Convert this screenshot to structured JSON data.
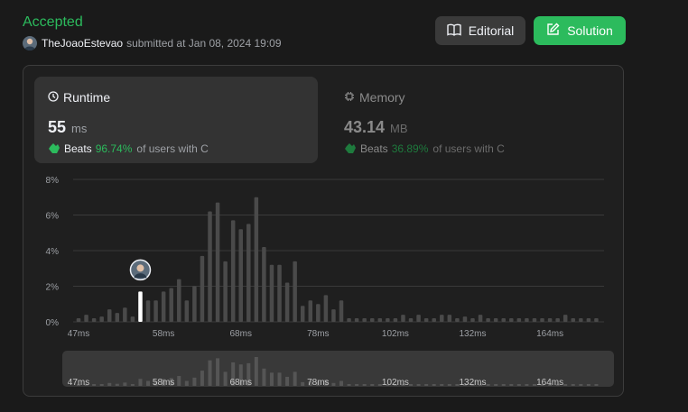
{
  "header": {
    "status": "Accepted",
    "username": "TheJoaoEstevao",
    "submitted_text": "submitted at Jan 08, 2024 19:09",
    "editorial_label": "Editorial",
    "solution_label": "Solution"
  },
  "runtime": {
    "title": "Runtime",
    "value": "55",
    "unit": "ms",
    "beats_label": "Beats",
    "beats_pct": "96.74%",
    "beats_suffix": "of users with C"
  },
  "memory": {
    "title": "Memory",
    "value": "43.14",
    "unit": "MB",
    "beats_label": "Beats",
    "beats_pct": "36.89%",
    "beats_suffix": "of users with C"
  },
  "colors": {
    "accent_green": "#2cbb5d",
    "background": "#1a1a1a",
    "bar": "#4a4a4a",
    "highlight_bar": "#ffffff"
  },
  "chart_data": {
    "type": "bar",
    "ylim": [
      0,
      8
    ],
    "yticks": [
      "0%",
      "2%",
      "4%",
      "6%",
      "8%"
    ],
    "xticks": [
      {
        "label": "47ms",
        "i": 0
      },
      {
        "label": "58ms",
        "i": 11
      },
      {
        "label": "68ms",
        "i": 21
      },
      {
        "label": "78ms",
        "i": 31
      },
      {
        "label": "102ms",
        "i": 41
      },
      {
        "label": "132ms",
        "i": 51
      },
      {
        "label": "164ms",
        "i": 61
      }
    ],
    "highlight_index": 8,
    "values": [
      0.2,
      0.4,
      0.2,
      0.3,
      0.7,
      0.5,
      0.8,
      0.3,
      1.7,
      1.2,
      1.2,
      1.7,
      1.9,
      2.4,
      1.2,
      2.0,
      3.7,
      6.2,
      6.7,
      3.4,
      5.7,
      5.2,
      5.5,
      7.0,
      4.2,
      3.2,
      3.2,
      2.2,
      3.4,
      0.9,
      1.2,
      1.0,
      1.5,
      0.7,
      1.2,
      0.2,
      0.2,
      0.2,
      0.2,
      0.2,
      0.2,
      0.2,
      0.4,
      0.2,
      0.4,
      0.2,
      0.2,
      0.4,
      0.4,
      0.2,
      0.3,
      0.2,
      0.4,
      0.2,
      0.2,
      0.2,
      0.2,
      0.2,
      0.2,
      0.2,
      0.2,
      0.2,
      0.2,
      0.4,
      0.2,
      0.2,
      0.2,
      0.2
    ]
  }
}
